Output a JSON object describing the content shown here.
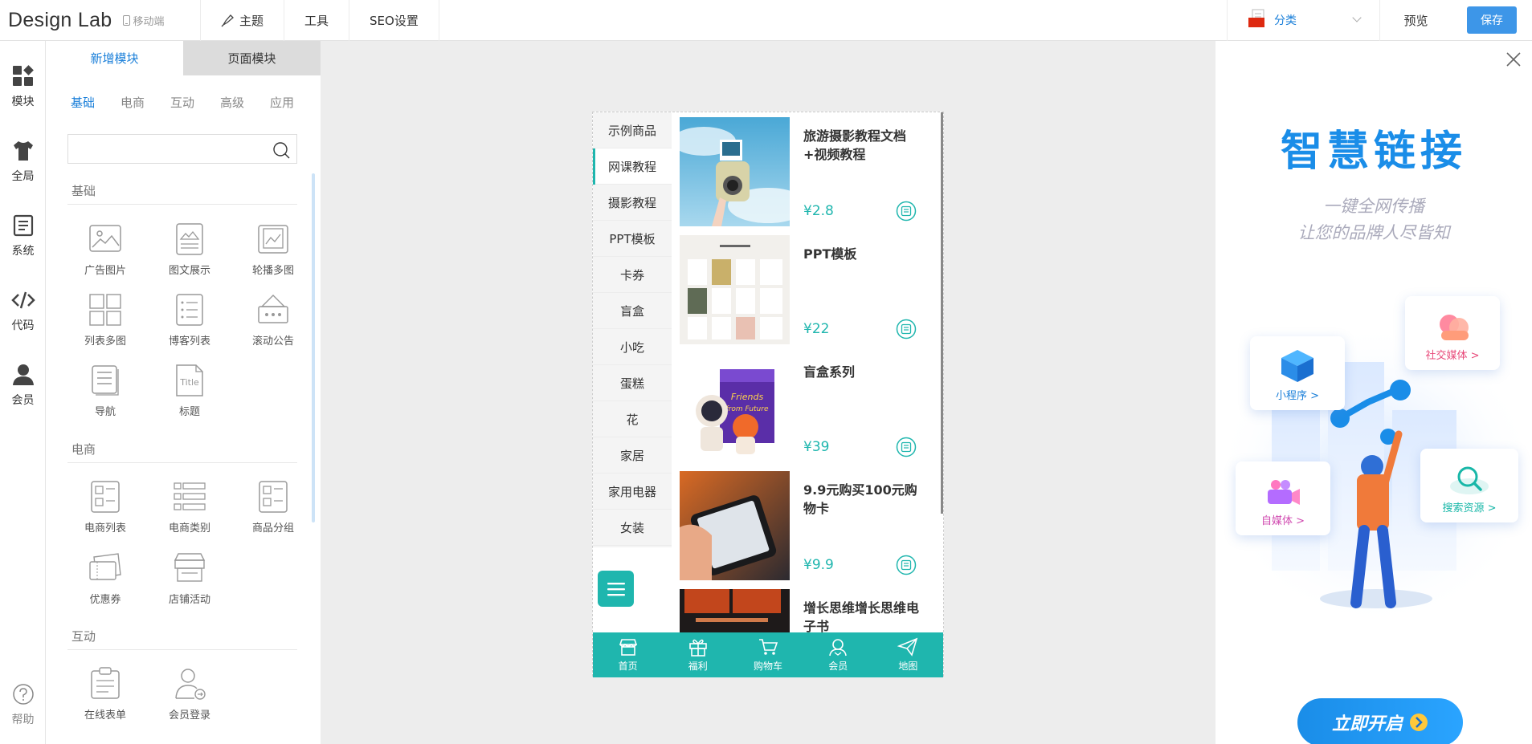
{
  "header": {
    "logo": "Design Lab",
    "device": "移动端",
    "nav": [
      "主题",
      "工具",
      "SEO设置"
    ],
    "category": "分类",
    "preview": "预览",
    "save": "保存"
  },
  "left_nav": [
    "模块",
    "全局",
    "系统",
    "代码",
    "会员",
    "帮助"
  ],
  "panel": {
    "tabs": [
      "新增模块",
      "页面模块"
    ],
    "subtabs": [
      "基础",
      "电商",
      "互动",
      "高级",
      "应用"
    ],
    "search_placeholder": "",
    "sections": [
      {
        "title": "基础",
        "items": [
          "广告图片",
          "图文展示",
          "轮播多图",
          "列表多图",
          "博客列表",
          "滚动公告",
          "导航",
          "标题"
        ]
      },
      {
        "title": "电商",
        "items": [
          "电商列表",
          "电商类别",
          "商品分组",
          "优惠券",
          "店铺活动"
        ]
      },
      {
        "title": "互动",
        "items": [
          "在线表单",
          "会员登录"
        ]
      }
    ]
  },
  "phone": {
    "categories": [
      "示例商品",
      "网课教程",
      "摄影教程",
      "PPT模板",
      "卡券",
      "盲盒",
      "小吃",
      "蛋糕",
      "花",
      "家居",
      "家用电器",
      "女装"
    ],
    "active_category": 1,
    "products": [
      {
        "title": "旅游摄影教程文档+视频教程",
        "price": "¥2.8"
      },
      {
        "title": "PPT模板",
        "price": "¥22"
      },
      {
        "title": "盲盒系列",
        "price": "¥39"
      },
      {
        "title": "9.9元购买100元购物卡",
        "price": "¥9.9"
      },
      {
        "title": "增长思维增长思维电子书",
        "price": ""
      }
    ],
    "bottom_nav": [
      "首页",
      "福利",
      "购物车",
      "会员",
      "地图"
    ]
  },
  "ad": {
    "title": "智慧链接",
    "sub1": "一键全网传播",
    "sub2": "让您的品牌人尽皆知",
    "cards": [
      "小程序 >",
      "社交媒体 >",
      "自媒体 >",
      "搜索资源 >"
    ],
    "button": "立即开启"
  },
  "colors": {
    "accent": "#1a7fd9",
    "teal": "#1fb6ae",
    "save": "#3d96e8"
  }
}
